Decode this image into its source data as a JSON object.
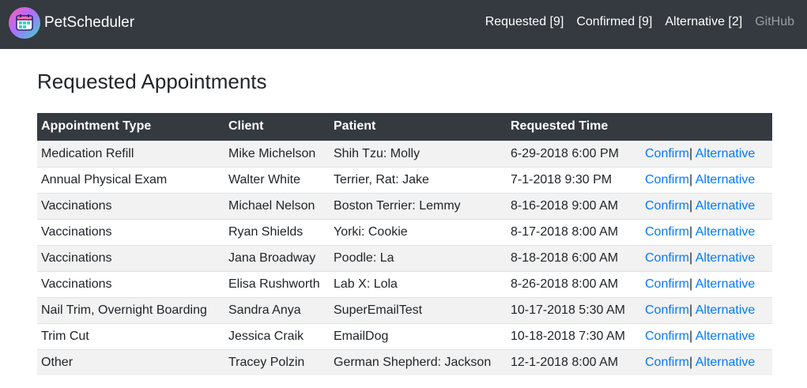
{
  "app": {
    "brand": "PetScheduler"
  },
  "nav": [
    {
      "label": "Requested [9]"
    },
    {
      "label": "Confirmed [9]"
    },
    {
      "label": "Alternative [2]"
    },
    {
      "label": "GitHub"
    }
  ],
  "page": {
    "title": "Requested Appointments"
  },
  "table": {
    "headers": [
      "Appointment Type",
      "Client",
      "Patient",
      "Requested Time",
      ""
    ],
    "confirm_label": "Confirm",
    "separator": "|",
    "alternative_label": "Alternative",
    "rows": [
      {
        "type": "Medication Refill",
        "client": "Mike Michelson",
        "patient": "Shih Tzu: Molly",
        "time": "6-29-2018 6:00 PM"
      },
      {
        "type": "Annual Physical Exam",
        "client": "Walter White",
        "patient": "Terrier, Rat: Jake",
        "time": "7-1-2018 9:30 PM"
      },
      {
        "type": "Vaccinations",
        "client": "Michael Nelson",
        "patient": "Boston Terrier: Lemmy",
        "time": "8-16-2018 9:00 AM"
      },
      {
        "type": "Vaccinations",
        "client": "Ryan Shields",
        "patient": "Yorki: Cookie",
        "time": "8-17-2018 8:00 AM"
      },
      {
        "type": "Vaccinations",
        "client": "Jana Broadway",
        "patient": "Poodle: La",
        "time": "8-18-2018 6:00 AM"
      },
      {
        "type": "Vaccinations",
        "client": "Elisa Rushworth",
        "patient": "Lab X: Lola",
        "time": "8-26-2018 8:00 AM"
      },
      {
        "type": "Nail Trim, Overnight Boarding",
        "client": "Sandra Anya",
        "patient": "SuperEmailTest",
        "time": "10-17-2018 5:30 AM"
      },
      {
        "type": "Trim Cut",
        "client": "Jessica Craik",
        "patient": "EmailDog",
        "time": "10-18-2018 7:30 AM"
      },
      {
        "type": "Other",
        "client": "Tracey Polzin",
        "patient": "German Shepherd: Jackson",
        "time": "12-1-2018 8:00 AM"
      }
    ]
  },
  "colors": {
    "navbar": "#343a40",
    "link": "#007bff",
    "stripe": "#f2f2f2"
  }
}
